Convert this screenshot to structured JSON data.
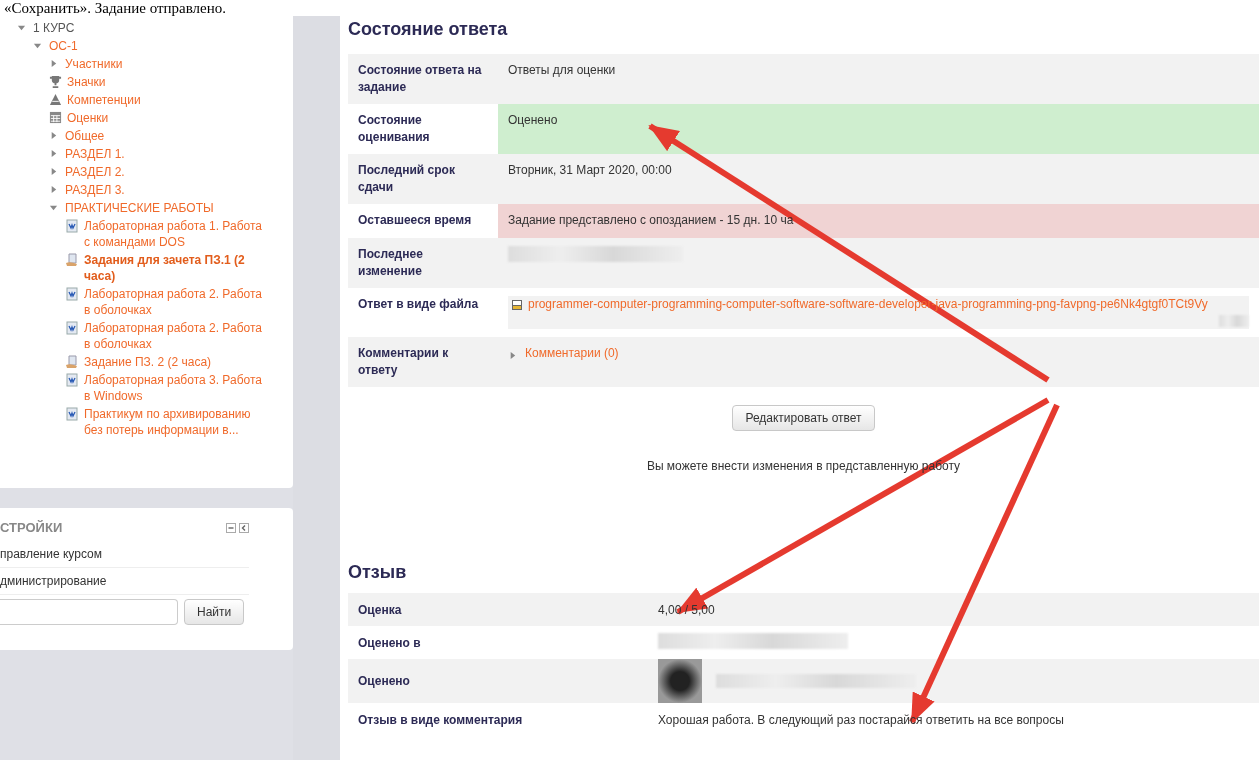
{
  "document_text": "«Сохранить». Задание отправлено.",
  "navigation": {
    "tree": [
      {
        "label": "1 КУРС",
        "kind": "branch",
        "expanded": true,
        "current": false,
        "children": [
          {
            "label": "ОС-1",
            "kind": "branch",
            "expanded": true,
            "current": false,
            "children": [
              {
                "label": "Участники",
                "kind": "branch",
                "expanded": false,
                "current": false
              },
              {
                "label": "Значки",
                "kind": "trophy",
                "current": false
              },
              {
                "label": "Компетенции",
                "kind": "competency",
                "current": false
              },
              {
                "label": "Оценки",
                "kind": "grades",
                "current": false
              },
              {
                "label": "Общее",
                "kind": "branch",
                "expanded": false,
                "current": false
              },
              {
                "label": "РАЗДЕЛ 1.",
                "kind": "branch",
                "expanded": false,
                "current": false
              },
              {
                "label": "РАЗДЕЛ 2.",
                "kind": "branch",
                "expanded": false,
                "current": false
              },
              {
                "label": "РАЗДЕЛ 3.",
                "kind": "branch",
                "expanded": false,
                "current": false
              },
              {
                "label": "ПРАКТИЧЕСКИЕ РАБОТЫ",
                "kind": "branch",
                "expanded": true,
                "current": false,
                "children": [
                  {
                    "label": "Лабораторная работа 1. Работа с командами DOS",
                    "kind": "document",
                    "current": false
                  },
                  {
                    "label": "Задания для зачета ПЗ.1 (2 часа)",
                    "kind": "assignment",
                    "current": true
                  },
                  {
                    "label": "Лабораторная работа 2. Работа в оболочках",
                    "kind": "document",
                    "current": false
                  },
                  {
                    "label": "Лабораторная работа 2. Работа в оболочках",
                    "kind": "document",
                    "current": false
                  },
                  {
                    "label": "Задание ПЗ. 2 (2 часа)",
                    "kind": "assignment",
                    "current": false
                  },
                  {
                    "label": "Лабораторная работа 3. Работа в Windows",
                    "kind": "document",
                    "current": false
                  },
                  {
                    "label": "Практикум по архивированию без потерь информации в...",
                    "kind": "document",
                    "current": false
                  }
                ]
              }
            ]
          }
        ]
      }
    ]
  },
  "settings": {
    "title": "СТРОЙКИ",
    "items": [
      "правление курсом",
      "дминистрирование"
    ],
    "search_button": "Найти"
  },
  "submission_status": {
    "heading": "Состояние ответа",
    "rows": [
      {
        "label": "Состояние ответа на задание",
        "value": "Ответы для оценки",
        "color": "#f2f2f2",
        "kind": "text"
      },
      {
        "label": "Состояние оценивания",
        "value": "Оценено",
        "color": "#cfeecf",
        "kind": "text"
      },
      {
        "label": "Последний срок сдачи",
        "value": "Вторник, 31 Март 2020, 00:00",
        "color": "#f2f2f2",
        "kind": "text"
      },
      {
        "label": "Оставшееся время",
        "value": "Задание представлено с опозданием - 15 дн. 10 ча",
        "color": "#f0d3d3",
        "kind": "text"
      },
      {
        "label": "Последнее изменение",
        "color": "#f2f2f2",
        "kind": "blurred"
      },
      {
        "label": "Ответ в виде файла",
        "value": "programmer-computer-programming-computer-software-software-developer-java-programming-png-favpng-pe6Nk4gtgf0TCt9Vy",
        "color": "#ffffff",
        "kind": "file"
      },
      {
        "label": "Комментарии к ответу",
        "value": "Комментарии (0)",
        "color": "#f2f2f2",
        "kind": "comments",
        "expanded": false
      }
    ],
    "edit_button": "Редактировать ответ",
    "note": "Вы можете внести изменения в представленную работу"
  },
  "feedback": {
    "heading": "Отзыв",
    "rows": [
      {
        "label": "Оценка",
        "value": "4,00 / 5,00",
        "kind": "text"
      },
      {
        "label": "Оценено в",
        "kind": "blurred"
      },
      {
        "label": "Оценено",
        "kind": "avatar"
      },
      {
        "label": "Отзыв в виде комментария",
        "value": "Хорошая работа. В следующий раз постарайся ответить на все вопросы",
        "kind": "text"
      }
    ]
  }
}
